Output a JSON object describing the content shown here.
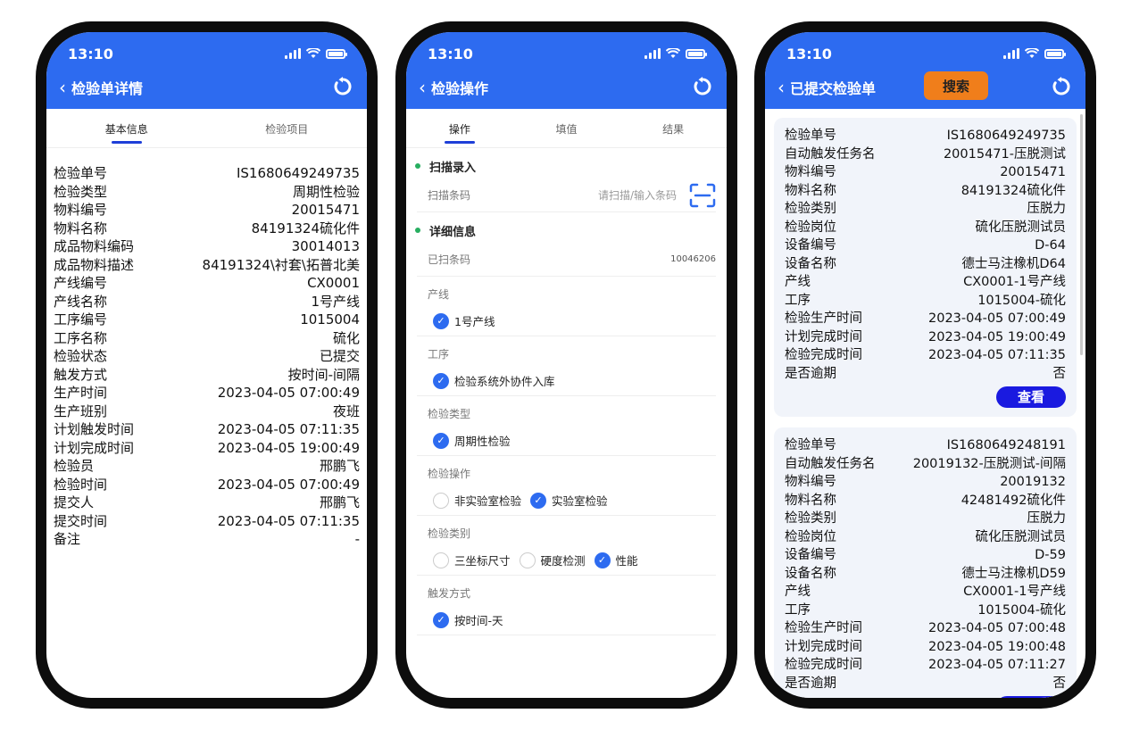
{
  "status_time": "13:10",
  "phone1": {
    "title": "检验单详情",
    "tabs": [
      "基本信息",
      "检验项目"
    ],
    "fields": [
      {
        "k": "检验单号",
        "v": "IS1680649249735"
      },
      {
        "k": "检验类型",
        "v": "周期性检验"
      },
      {
        "k": "物料编号",
        "v": "20015471"
      },
      {
        "k": "物料名称",
        "v": "84191324硫化件"
      },
      {
        "k": "成品物料编码",
        "v": "30014013"
      },
      {
        "k": "成品物料描述",
        "v": "84191324\\衬套\\拓普北美"
      },
      {
        "k": "产线编号",
        "v": "CX0001"
      },
      {
        "k": "产线名称",
        "v": "1号产线"
      },
      {
        "k": "工序编号",
        "v": "1015004"
      },
      {
        "k": "工序名称",
        "v": "硫化"
      },
      {
        "k": "检验状态",
        "v": "已提交"
      },
      {
        "k": "触发方式",
        "v": "按时间-间隔"
      },
      {
        "k": "生产时间",
        "v": "2023-04-05 07:00:49"
      },
      {
        "k": "生产班别",
        "v": "夜班"
      },
      {
        "k": "计划触发时间",
        "v": "2023-04-05 07:11:35"
      },
      {
        "k": "计划完成时间",
        "v": "2023-04-05 19:00:49"
      },
      {
        "k": "检验员",
        "v": "邢鹏飞"
      },
      {
        "k": "检验时间",
        "v": "2023-04-05 07:00:49"
      },
      {
        "k": "提交人",
        "v": "邢鹏飞"
      },
      {
        "k": "提交时间",
        "v": "2023-04-05 07:11:35"
      },
      {
        "k": "备注",
        "v": "-"
      }
    ]
  },
  "phone2": {
    "title": "检验操作",
    "tabs": [
      "操作",
      "填值",
      "结果"
    ],
    "scan_section": "扫描录入",
    "scan_label": "扫描条码",
    "scan_placeholder": "请扫描/输入条码",
    "detail_section": "详细信息",
    "scanned_label": "已扫条码",
    "scanned_value": "10046206",
    "groups": [
      {
        "label": "产线",
        "options": [
          {
            "text": "1号产线",
            "checked": true
          }
        ]
      },
      {
        "label": "工序",
        "options": [
          {
            "text": "检验系统外协件入库",
            "checked": true
          }
        ]
      },
      {
        "label": "检验类型",
        "options": [
          {
            "text": "周期性检验",
            "checked": true
          }
        ]
      },
      {
        "label": "检验操作",
        "options": [
          {
            "text": "非实验室检验",
            "checked": false
          },
          {
            "text": "实验室检验",
            "checked": true
          }
        ]
      },
      {
        "label": "检验类别",
        "options": [
          {
            "text": "三坐标尺寸",
            "checked": false
          },
          {
            "text": "硬度检测",
            "checked": false
          },
          {
            "text": "性能",
            "checked": true
          }
        ]
      },
      {
        "label": "触发方式",
        "options": [
          {
            "text": "按时间-天",
            "checked": true
          }
        ]
      }
    ]
  },
  "phone3": {
    "title": "已提交检验单",
    "search_label": "搜索",
    "view_label": "查看",
    "cards": [
      {
        "fields": [
          {
            "k": "检验单号",
            "v": "IS1680649249735"
          },
          {
            "k": "自动触发任务名",
            "v": "20015471-压脱测试"
          },
          {
            "k": "物料编号",
            "v": "20015471"
          },
          {
            "k": "物料名称",
            "v": "84191324硫化件"
          },
          {
            "k": "检验类别",
            "v": "压脱力"
          },
          {
            "k": "检验岗位",
            "v": "硫化压脱测试员"
          },
          {
            "k": "设备编号",
            "v": "D-64"
          },
          {
            "k": "设备名称",
            "v": "德士马注橡机D64"
          },
          {
            "k": "产线",
            "v": "CX0001-1号产线"
          },
          {
            "k": "工序",
            "v": "1015004-硫化"
          },
          {
            "k": "检验生产时间",
            "v": "2023-04-05 07:00:49"
          },
          {
            "k": "计划完成时间",
            "v": "2023-04-05 19:00:49"
          },
          {
            "k": "检验完成时间",
            "v": "2023-04-05 07:11:35"
          },
          {
            "k": "是否逾期",
            "v": "否"
          }
        ]
      },
      {
        "fields": [
          {
            "k": "检验单号",
            "v": "IS1680649248191"
          },
          {
            "k": "自动触发任务名",
            "v": "20019132-压脱测试-间隔"
          },
          {
            "k": "物料编号",
            "v": "20019132"
          },
          {
            "k": "物料名称",
            "v": "42481492硫化件"
          },
          {
            "k": "检验类别",
            "v": "压脱力"
          },
          {
            "k": "检验岗位",
            "v": "硫化压脱测试员"
          },
          {
            "k": "设备编号",
            "v": "D-59"
          },
          {
            "k": "设备名称",
            "v": "德士马注橡机D59"
          },
          {
            "k": "产线",
            "v": "CX0001-1号产线"
          },
          {
            "k": "工序",
            "v": "1015004-硫化"
          },
          {
            "k": "检验生产时间",
            "v": "2023-04-05 07:00:48"
          },
          {
            "k": "计划完成时间",
            "v": "2023-04-05 19:00:48"
          },
          {
            "k": "检验完成时间",
            "v": "2023-04-05 07:11:27"
          },
          {
            "k": "是否逾期",
            "v": "否"
          }
        ]
      }
    ]
  },
  "colors": {
    "header": "#2d6bf0",
    "tab_indicator": "#1e3fd8",
    "check": "#2d6bf0",
    "search_button": "#f07e1b",
    "view_button": "#1a1ae0",
    "section_dot": "#27ae60"
  }
}
